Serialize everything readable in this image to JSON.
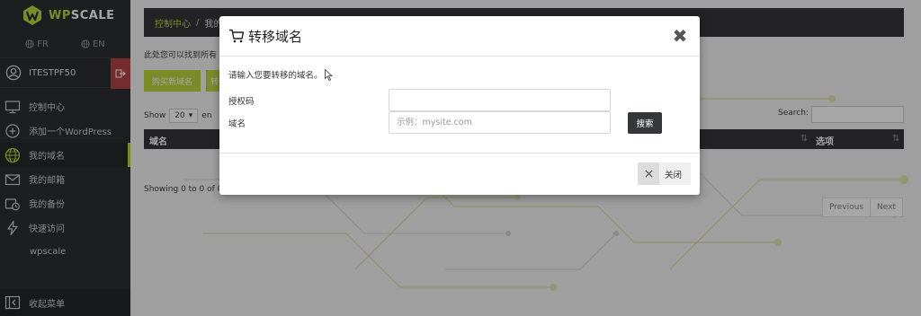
{
  "brand": {
    "wp": "WP",
    "scale": "SCALE",
    "accent": "#b8d432"
  },
  "languages": [
    {
      "code": "FR"
    },
    {
      "code": "EN"
    }
  ],
  "user": {
    "name": "ITESTPF50"
  },
  "menu": [
    {
      "label": "控制中心",
      "icon": "monitor-icon"
    },
    {
      "label": "添加一个WordPress",
      "icon": "plus-circle-icon"
    },
    {
      "label": "我的域名",
      "icon": "globe-icon",
      "active": true
    },
    {
      "label": "我的邮箱",
      "icon": "mail-icon"
    },
    {
      "label": "我的备份",
      "icon": "backup-icon"
    },
    {
      "label": "快速访问",
      "icon": "bolt-icon"
    },
    {
      "label": "wpscale"
    }
  ],
  "collapse_label": "收起菜单",
  "breadcrumb": {
    "home": "控制中心",
    "separator": "/",
    "current": "我的"
  },
  "page": {
    "description": "此处您可以找到所有",
    "buttons": [
      "购买新域名",
      "转"
    ],
    "show_label": "Show",
    "show_value": "20",
    "entries_label": "en",
    "search_label": "Search:",
    "columns": [
      "域名",
      "选项"
    ],
    "info": "Showing 0 to 0 of 0",
    "pager": [
      "Previous",
      "Next"
    ]
  },
  "modal": {
    "title": "转移域名",
    "close_symbol": "✖",
    "prompt": "请输入您要转移的域名。",
    "auth_label": "授权码",
    "auth_value": "",
    "domain_label": "域名",
    "domain_placeholder": "示例：mysite.com",
    "search_button": "搜索",
    "close_button": "关闭"
  }
}
